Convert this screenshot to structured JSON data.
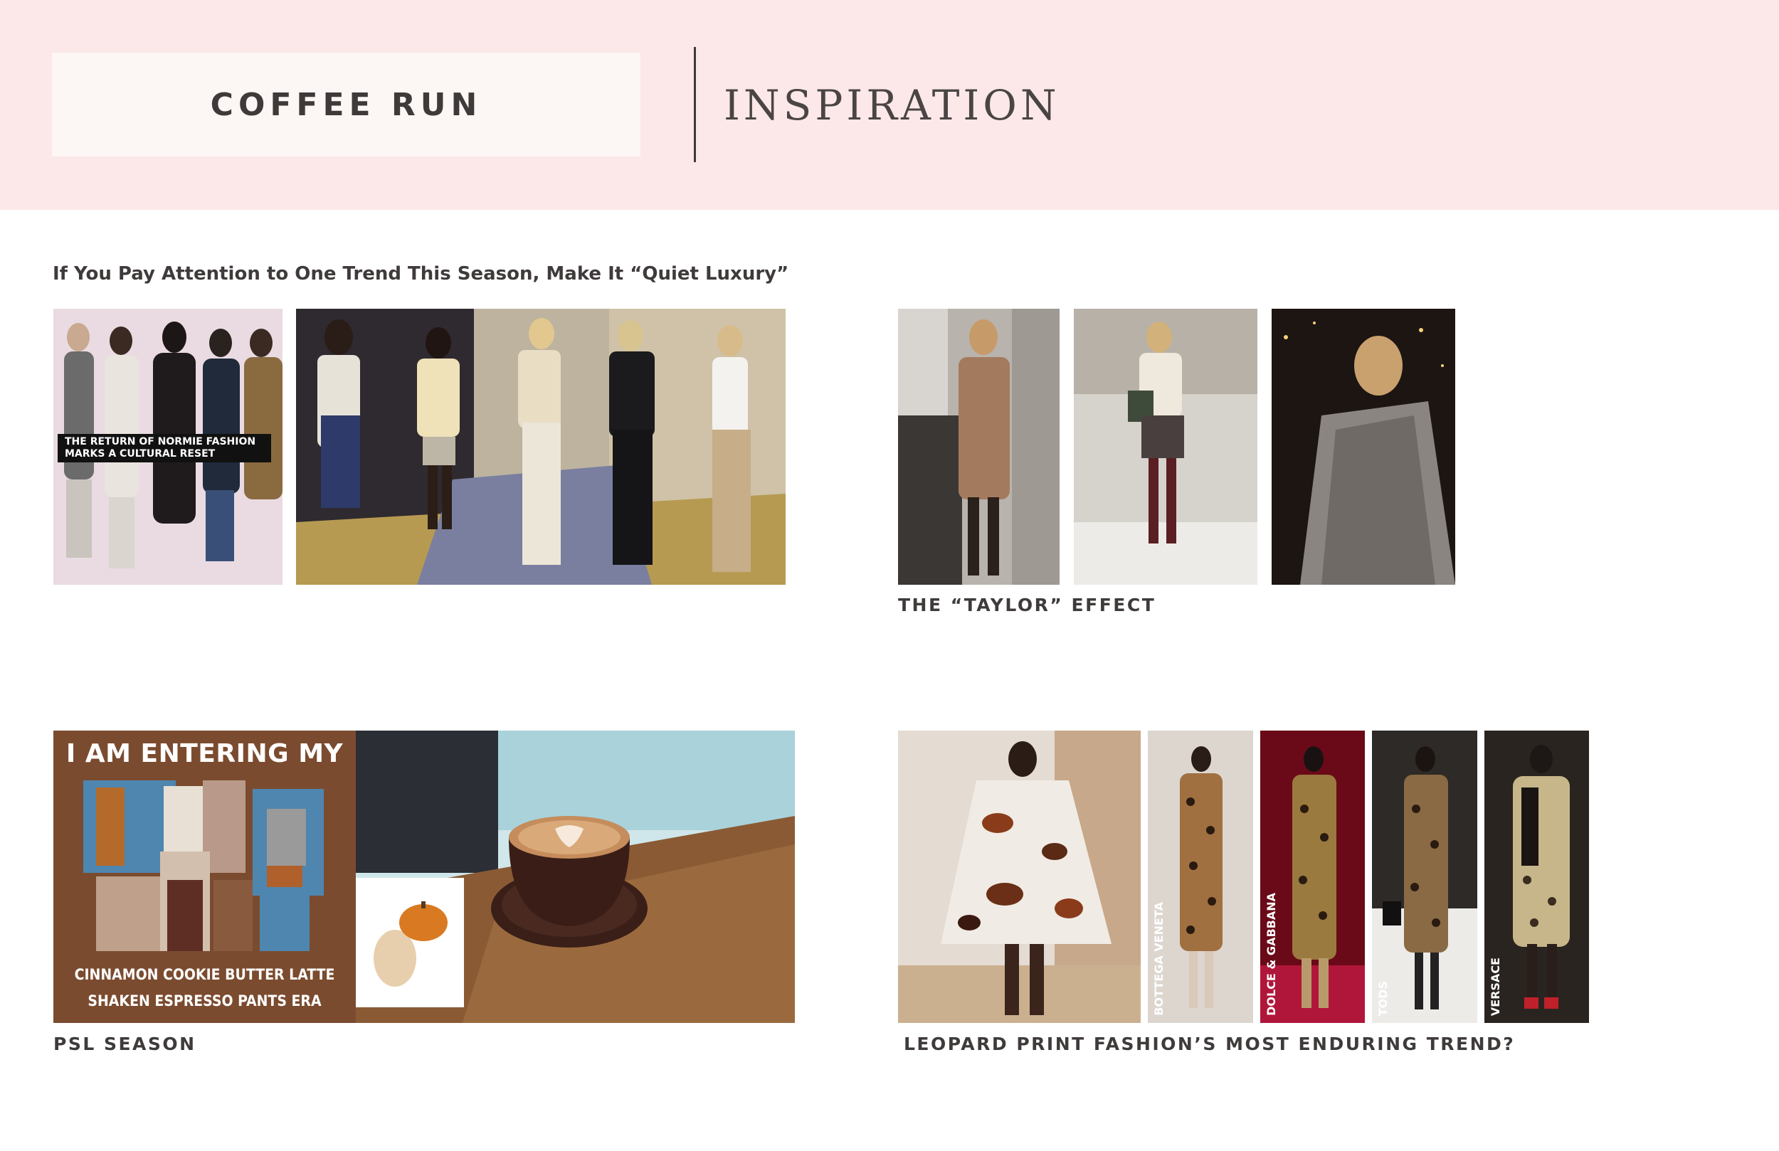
{
  "header": {
    "brand": "COFFEE RUN",
    "section": "INSPIRATION"
  },
  "quiet_luxury": {
    "headline": "If You Pay Attention to One Trend This Season, Make It “Quiet Luxury”",
    "image_caption_line1": "THE RETURN OF NORMIE FASHION",
    "image_caption_line2": "MARKS A CULTURAL RESET"
  },
  "taylor": {
    "caption": "THE “TAYLOR” EFFECT"
  },
  "psl": {
    "caption": "PSL SEASON",
    "poster_title": "I AM ENTERING MY",
    "poster_line1": "CINNAMON COOKIE BUTTER LATTE",
    "poster_line2": "SHAKEN ESPRESSO PANTS ERA"
  },
  "leopard": {
    "caption": "LEOPARD PRINT FASHION’S MOST ENDURING TREND?",
    "brands": [
      "BOTTEGA VENETA",
      "DOLCE & GABBANA",
      "TODS",
      "VERSACE"
    ]
  },
  "colors": {
    "header_bg": "#fce8e8",
    "brand_box": "#fcf6f5",
    "text": "#3f3b3a"
  }
}
